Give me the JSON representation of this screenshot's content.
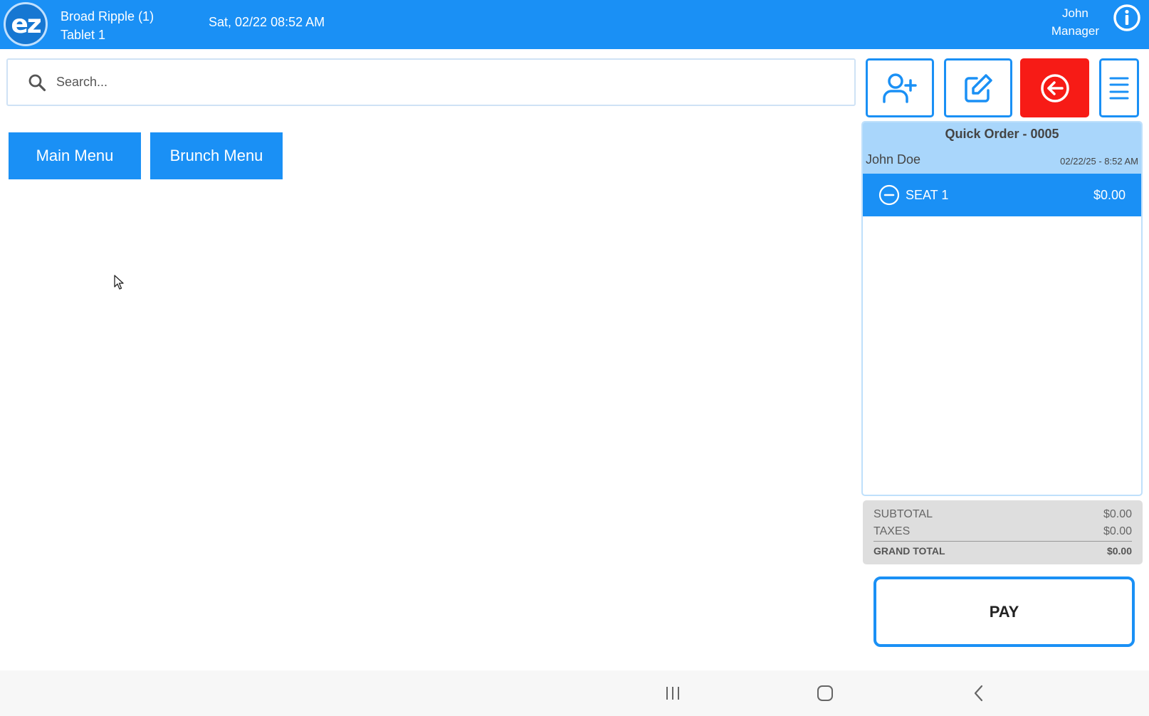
{
  "header": {
    "logo_text": "ez",
    "location": "Broad Ripple (1)",
    "device": "Tablet 1",
    "datetime": "Sat, 02/22 08:52 AM",
    "user_name": "John",
    "user_role": "Manager"
  },
  "search": {
    "placeholder": "Search..."
  },
  "actions": [
    {
      "icon": "add-user-icon"
    },
    {
      "icon": "edit-icon"
    },
    {
      "icon": "back-arrow-icon",
      "color": "#f71b16"
    },
    {
      "icon": "hamburger-menu-icon"
    }
  ],
  "menus": [
    {
      "label": "Main Menu"
    },
    {
      "label": "Brunch Menu"
    }
  ],
  "order": {
    "title": "Quick Order - 0005",
    "customer": "John Doe",
    "timestamp": "02/22/25  - 8:52 AM",
    "seats": [
      {
        "label": "SEAT 1",
        "amount": "$0.00"
      }
    ]
  },
  "totals": {
    "subtotal_label": "SUBTOTAL",
    "subtotal": "$0.00",
    "taxes_label": "TAXES",
    "taxes": "$0.00",
    "grand_total_label": "GRAND TOTAL",
    "grand_total": "$0.00"
  },
  "pay_label": "PAY",
  "colors": {
    "primary": "#1a90f5",
    "danger": "#f71b16",
    "order_header": "#a9d6fb"
  }
}
